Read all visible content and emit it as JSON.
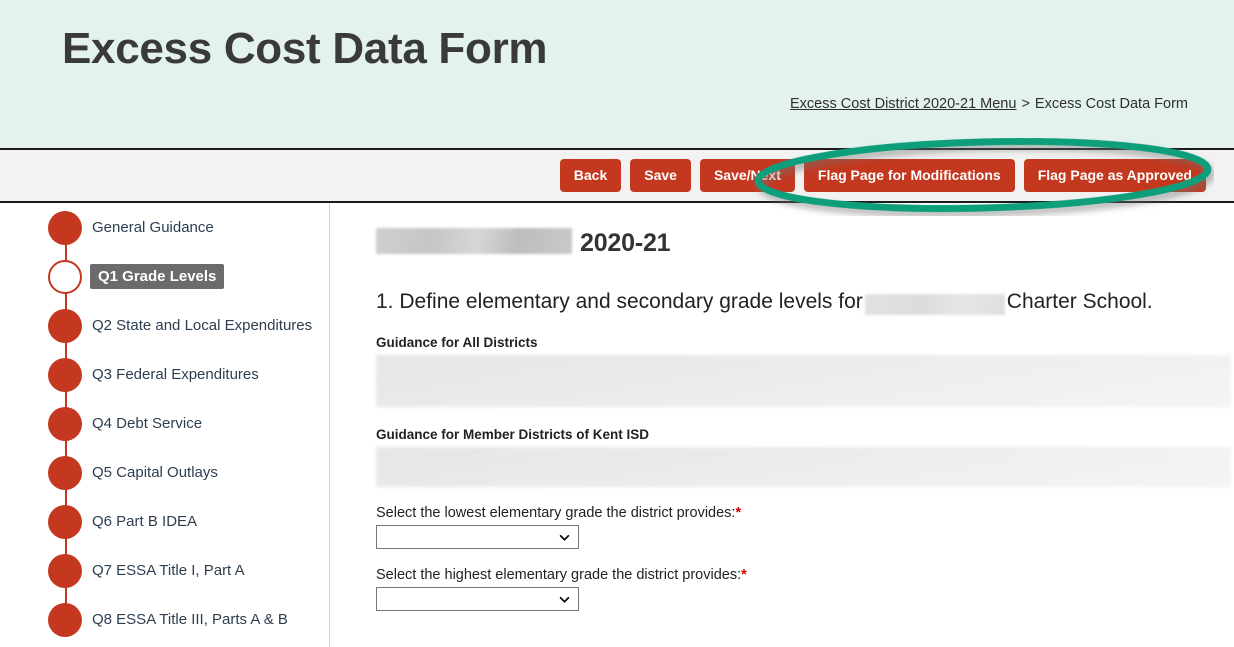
{
  "header": {
    "title": "Excess Cost Data Form",
    "background_color": "#e4f2ee",
    "breadcrumb": {
      "link_label": "Excess Cost District 2020-21 Menu",
      "separator": ">",
      "current_label": "Excess Cost Data Form"
    }
  },
  "toolbar": {
    "background_color": "#f2f2f2",
    "button_color": "#c3381f",
    "buttons": [
      {
        "label": "Back",
        "name": "back-button"
      },
      {
        "label": "Save",
        "name": "save-button"
      },
      {
        "label": "Save/Next",
        "name": "save-next-button"
      },
      {
        "label": "Flag Page for Modifications",
        "name": "flag-page-for-modifications-button"
      },
      {
        "label": "Flag Page as Approved",
        "name": "flag-page-as-approved-button"
      }
    ]
  },
  "annotation": {
    "shape": "ellipse",
    "color": "#0f9e7c",
    "stroke_width": 7,
    "highlights": "Flag Page for Modifications and Flag Page as Approved buttons"
  },
  "sidebar": {
    "dot_color": "#c3381f",
    "active_label_bg": "#6b6b6b",
    "items": [
      {
        "label": "General Guidance",
        "active": false
      },
      {
        "label": "Q1 Grade Levels",
        "active": true
      },
      {
        "label": "Q2 State and Local Expenditures",
        "active": false
      },
      {
        "label": "Q3 Federal Expenditures",
        "active": false
      },
      {
        "label": "Q4 Debt Service",
        "active": false
      },
      {
        "label": "Q5 Capital Outlays",
        "active": false
      },
      {
        "label": "Q6 Part B IDEA",
        "active": false
      },
      {
        "label": "Q7 ESSA Title I, Part A",
        "active": false
      },
      {
        "label": "Q8 ESSA Title III, Parts A & B",
        "active": false
      }
    ]
  },
  "main": {
    "district_name_redacted": "",
    "year": "2020-21",
    "question": {
      "prefix": "1. Define elementary and secondary grade levels for",
      "redacted_name": "",
      "suffix": "Charter School."
    },
    "guidance_all_districts_label": "Guidance for All Districts",
    "guidance_all_districts_text": "",
    "guidance_kent_isd_label": "Guidance for Member Districts of Kent ISD",
    "guidance_kent_isd_text": "",
    "fields": [
      {
        "label": "Select the lowest elementary grade the district provides:",
        "required_marker": "*",
        "value": "",
        "name": "lowest-elementary-grade-select"
      },
      {
        "label": "Select the highest elementary grade the district provides:",
        "required_marker": "*",
        "value": "",
        "name": "highest-elementary-grade-select"
      }
    ]
  }
}
